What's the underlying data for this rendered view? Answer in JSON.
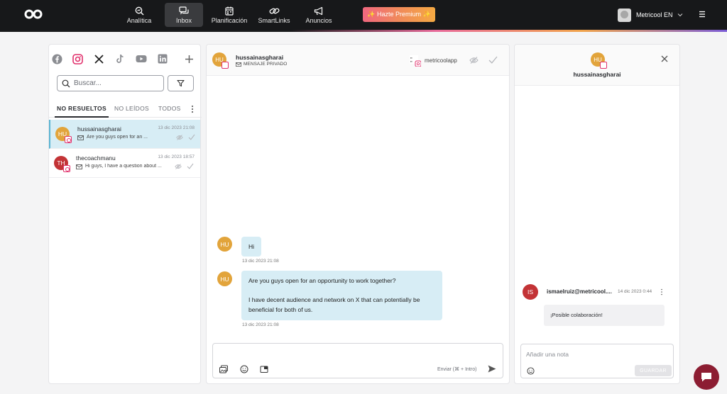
{
  "nav": {
    "items": [
      {
        "label": "Analítica",
        "icon": "analytics-icon"
      },
      {
        "label": "Inbox",
        "icon": "inbox-icon",
        "active": true
      },
      {
        "label": "Planificación",
        "icon": "calendar-icon"
      },
      {
        "label": "SmartLinks",
        "icon": "link-icon"
      },
      {
        "label": "Anuncios",
        "icon": "megaphone-icon"
      }
    ],
    "premium_label": "✨ Hazte Premium ✨",
    "account_name": "Metricool EN"
  },
  "inbox": {
    "search_placeholder": "Buscar...",
    "tabs": [
      "NO RESUELTOS",
      "NO LEÍDOS",
      "TODOS"
    ],
    "conversations": [
      {
        "initials": "HU",
        "name": "hussainasgharai",
        "date": "13 dic 2023 21:08",
        "preview": "Are you guys open for an ...",
        "avatar_color": "#e2a43b"
      },
      {
        "initials": "TH",
        "name": "thecoachmanu",
        "date": "13 dic 2023 18:57",
        "preview": "Hi guys, I have a question about ...",
        "avatar_color": "#c33336"
      }
    ]
  },
  "chat": {
    "initials": "HU",
    "name": "hussainasgharai",
    "type": "MENSAJE PRIVADO",
    "account": "metricoolapp",
    "messages": [
      {
        "initials": "HU",
        "lines": [
          "Hi"
        ],
        "time": "13 dic 2023 21:08"
      },
      {
        "initials": "HU",
        "lines": [
          "Are you guys open for an opportunity to work together?",
          "",
          "I have decent audience and network on X that can potentially be",
          "beneficial for both of us."
        ],
        "time": "13 dic 2023 21:08"
      }
    ],
    "send_hint": "Enviar (⌘ + Intro)"
  },
  "details": {
    "initials": "HU",
    "name": "hussainasgharai",
    "note": {
      "initials": "IS",
      "author": "ismaelruiz@metricool....",
      "date": "14 dic 2023 0:44",
      "text": "¡Posible colaboración!"
    },
    "note_placeholder": "Añadir una nota",
    "save_label": "GUARDAR"
  },
  "colors": {
    "accent_selected": "#d7edf5",
    "avatar_orange": "#e2a43b",
    "avatar_red": "#c33336",
    "instagram": "#e1306c",
    "fab": "#8c1d32"
  }
}
